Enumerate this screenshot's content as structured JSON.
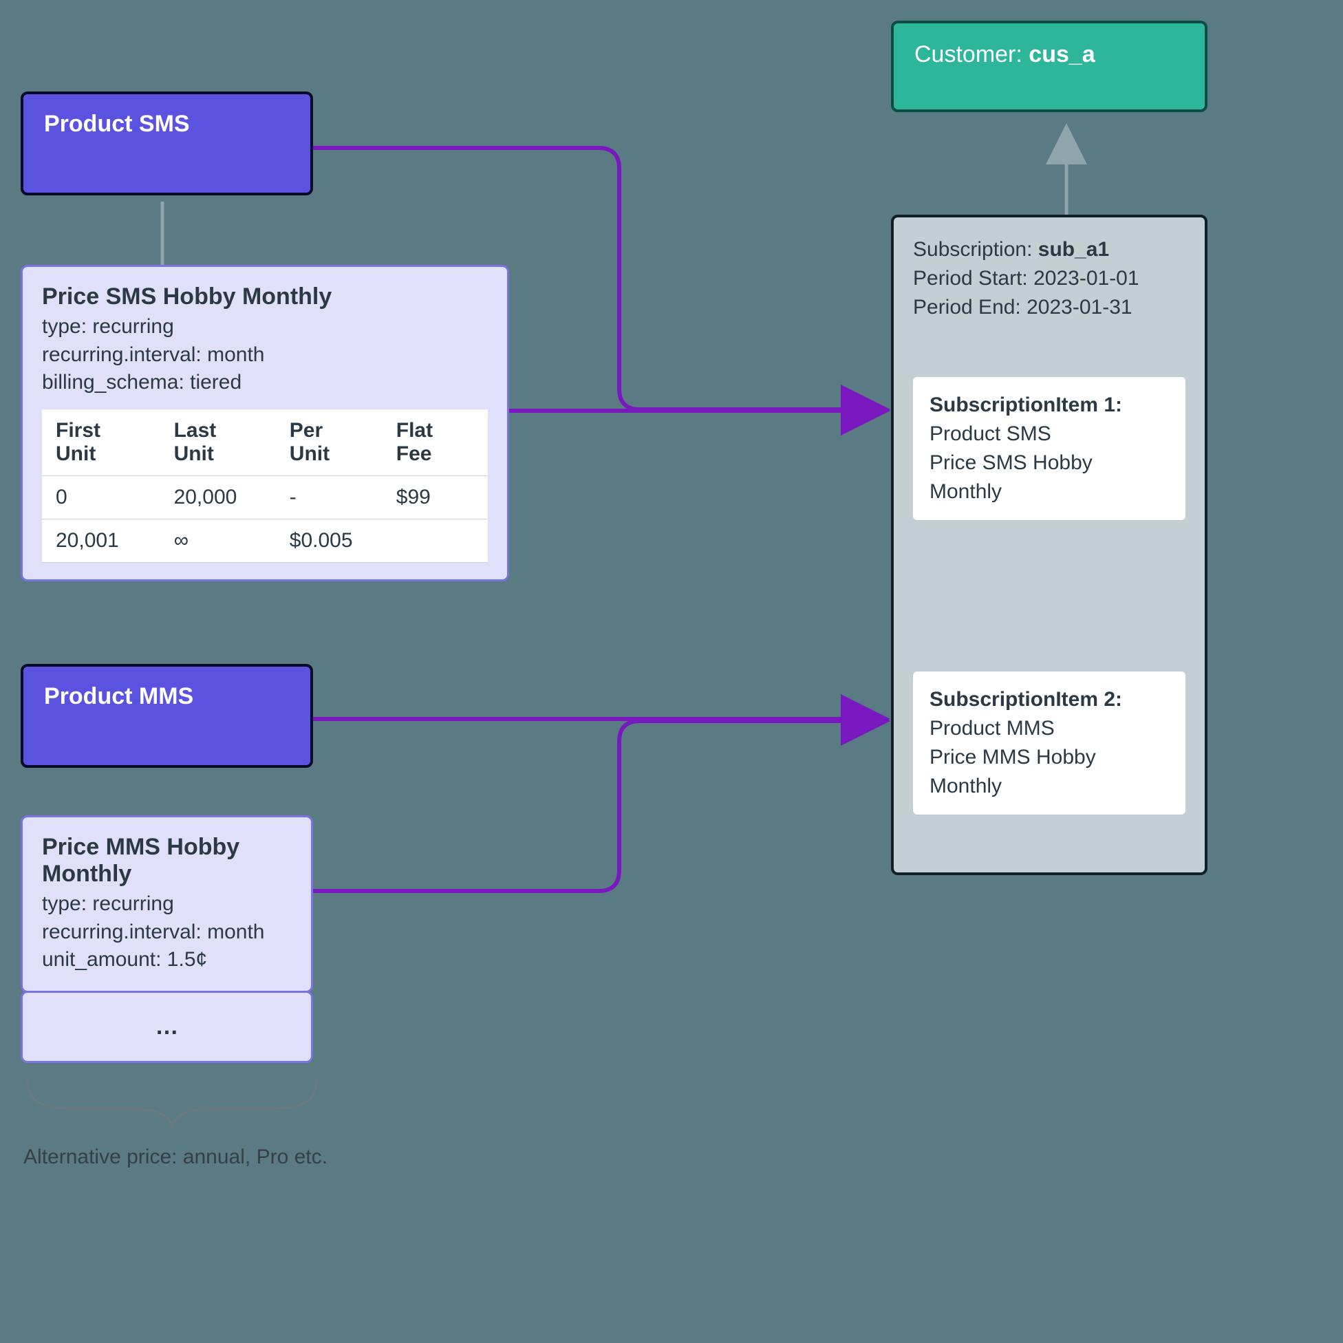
{
  "product_sms": {
    "title": "Product SMS"
  },
  "product_mms": {
    "title": "Product MMS"
  },
  "price_sms": {
    "title": "Price SMS Hobby Monthly",
    "type_label": "type:",
    "type_value": "recurring",
    "interval_label": "recurring.interval:",
    "interval_value": "month",
    "schema_label": "billing_schema:",
    "schema_value": "tiered",
    "cols": {
      "first": "First Unit",
      "last": "Last Unit",
      "per": "Per Unit",
      "flat": "Flat Fee"
    },
    "rows": [
      {
        "first": "0",
        "last": "20,000",
        "per": "-",
        "flat": "$99"
      },
      {
        "first": "20,001",
        "last": "∞",
        "per": "$0.005",
        "flat": ""
      }
    ]
  },
  "price_mms": {
    "title": "Price MMS Hobby Monthly",
    "type_label": "type:",
    "type_value": "recurring",
    "interval_label": "recurring.interval:",
    "interval_value": "month",
    "amount_label": "unit_amount:",
    "amount_value": "1.5¢"
  },
  "ellipsis": "…",
  "alt_note": "Alternative price: annual, Pro etc.",
  "customer": {
    "label": "Customer:",
    "id": "cus_a"
  },
  "subscription": {
    "label": "Subscription:",
    "id": "sub_a1",
    "start_label": "Period Start:",
    "start_value": "2023-01-01",
    "end_label": "Period End:",
    "end_value": "2023-01-31",
    "item1": {
      "header": "SubscriptionItem 1:",
      "l1": "Product SMS",
      "l2": "Price SMS Hobby Monthly"
    },
    "item2": {
      "header": "SubscriptionItem 2:",
      "l1": "Product MMS",
      "l2": "Price MMS Hobby Monthly"
    }
  }
}
